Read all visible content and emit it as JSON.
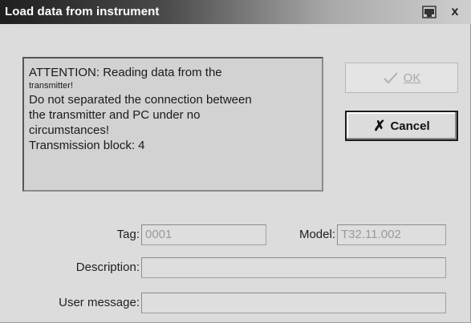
{
  "window": {
    "title": "Load data from instrument",
    "close_symbol": "x"
  },
  "message": {
    "line1": "ATTENTION: Reading data from the",
    "line2": "transmitter!",
    "line3": "Do not separated the connection between",
    "line4": "the transmitter and PC under no",
    "line5": "circumstances!",
    "line6": "Transmission block: 4"
  },
  "buttons": {
    "ok_label": "OK",
    "ok_icon": "checkmark-icon",
    "ok_enabled": false,
    "cancel_label": "Cancel",
    "cancel_icon": "x-icon",
    "cancel_symbol": "✗"
  },
  "fields": {
    "tag_label": "Tag:",
    "tag_value": "0001",
    "model_label": "Model:",
    "model_value": "T32.11.002",
    "description_label": "Description:",
    "description_value": "",
    "user_message_label": "User message:",
    "user_message_value": ""
  }
}
